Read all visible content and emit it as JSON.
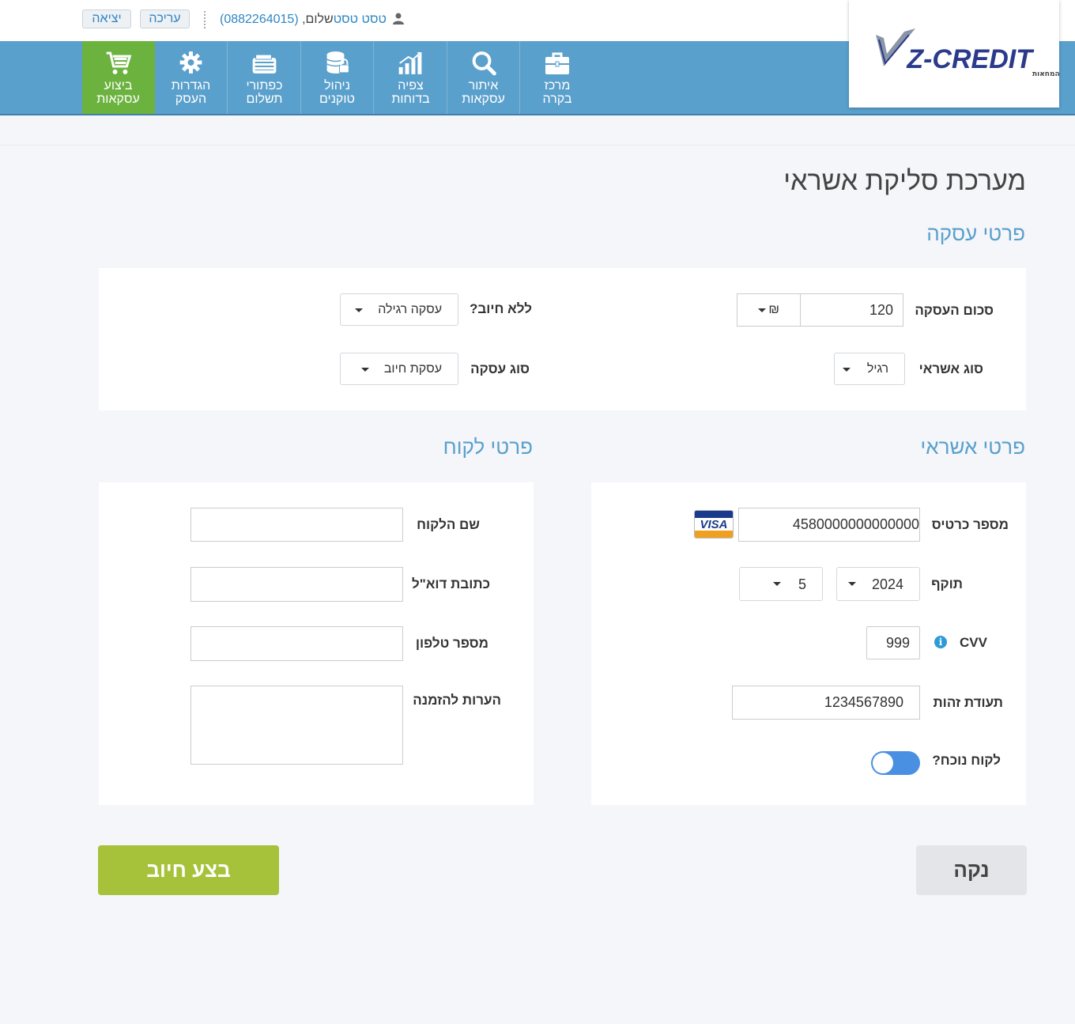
{
  "header": {
    "exit_label": "יציאה",
    "edit_label": "עריכה",
    "greeting_prefix": "שלום, ",
    "user_name": "טסט טסט",
    "user_id": "(0882264015)"
  },
  "nav": [
    {
      "label_line1": "ביצוע",
      "label_line2": "עסקאות",
      "icon": "shopping-cart-icon",
      "active": true
    },
    {
      "label_line1": "הגדרות",
      "label_line2": "העסק",
      "icon": "gear-icon"
    },
    {
      "label_line1": "כפתורי",
      "label_line2": "תשלום",
      "icon": "wallet-icon"
    },
    {
      "label_line1": "ניהול",
      "label_line2": "טוקנים",
      "icon": "database-lock-icon"
    },
    {
      "label_line1": "צפיה",
      "label_line2": "בדוחות",
      "icon": "bar-chart-icon"
    },
    {
      "label_line1": "איתור",
      "label_line2": "עסקאות",
      "icon": "search-icon"
    },
    {
      "label_line1": "מרכז",
      "label_line2": "בקרה",
      "icon": "briefcase-icon"
    }
  ],
  "logo": {
    "brand": "Z-CREDIT",
    "tagline": "סליקת אשראי והכנסת המחאות"
  },
  "colors": {
    "accent": "#5aa0cc",
    "active_nav": "#6cb23e",
    "charge_button": "#a6c23a"
  },
  "page_title": "מערכת סליקת אשראי",
  "transaction": {
    "section_title": "פרטי עסקה",
    "amount_label": "סכום העסקה",
    "amount_value": "120",
    "currency": "₪",
    "no_charge_label": "ללא חיוב?",
    "no_charge_value": "עסקה רגילה",
    "credit_type_label": "סוג אשראי",
    "credit_type_value": "רגיל",
    "deal_type_label": "סוג עסקה",
    "deal_type_value": "עסקת חיוב"
  },
  "credit": {
    "section_title": "פרטי אשראי",
    "card_number_label": "מספר כרטיס",
    "card_number_value": "4580000000000000",
    "card_brand": "VISA",
    "expiry_label": "תוקף",
    "expiry_year": "2024",
    "expiry_month": "5",
    "cvv_label": "CVV",
    "cvv_value": "999",
    "id_label": "תעודת זהות",
    "id_value": "1234567890",
    "present_label": "לקוח נוכח?"
  },
  "customer": {
    "section_title": "פרטי לקוח",
    "name_label": "שם הלקוח",
    "email_label": "כתובת דוא\"ל",
    "phone_label": "מספר טלפון",
    "notes_label": "הערות להזמנה"
  },
  "actions": {
    "charge_label": "בצע חיוב",
    "clear_label": "נקה"
  }
}
